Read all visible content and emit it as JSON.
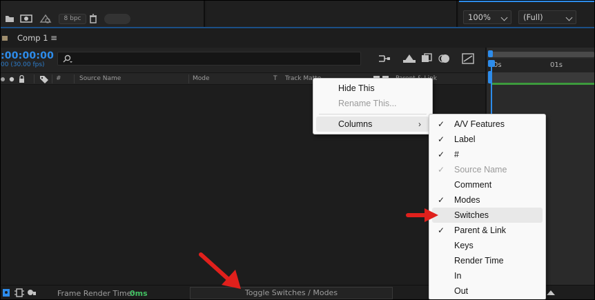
{
  "toolbar": {
    "bpc_label": "8 bpc",
    "zoom_value": "100%",
    "resolution_value": "(Full)"
  },
  "comp_tab": {
    "title": "Comp 1",
    "menu_glyph": "≡"
  },
  "timeline": {
    "timecode": ":00:00:00",
    "fps_text": "00 (30.00 fps)",
    "ruler_ticks": [
      "0s",
      "01s"
    ]
  },
  "columns": {
    "number": "#",
    "source_name": "Source Name",
    "mode": "Mode",
    "t": "T",
    "track_matte": "Track Matte",
    "parent_link": "Parent & Link"
  },
  "bottom": {
    "frame_render_label": "Frame Render Time:",
    "frame_render_value": "0ms",
    "toggle_label": "Toggle Switches / Modes"
  },
  "context_menu": {
    "items": [
      {
        "label": "Hide This",
        "enabled": true
      },
      {
        "label": "Rename This...",
        "enabled": false
      },
      {
        "label": "Columns",
        "enabled": true,
        "submenu": true
      }
    ]
  },
  "columns_submenu": {
    "items": [
      {
        "label": "A/V Features",
        "checked": true,
        "enabled": true
      },
      {
        "label": "Label",
        "checked": true,
        "enabled": true
      },
      {
        "label": "#",
        "checked": true,
        "enabled": true
      },
      {
        "label": "Source Name",
        "checked": true,
        "enabled": false
      },
      {
        "label": "Comment",
        "checked": false,
        "enabled": true
      },
      {
        "label": "Modes",
        "checked": true,
        "enabled": true
      },
      {
        "label": "Switches",
        "checked": false,
        "enabled": true,
        "highlighted": true
      },
      {
        "label": "Parent & Link",
        "checked": true,
        "enabled": true
      },
      {
        "label": "Keys",
        "checked": false,
        "enabled": true
      },
      {
        "label": "Render Time",
        "checked": false,
        "enabled": true
      },
      {
        "label": "In",
        "checked": false,
        "enabled": true
      },
      {
        "label": "Out",
        "checked": false,
        "enabled": true
      }
    ]
  },
  "colors": {
    "accent_blue": "#2d8ceb",
    "render_time_green": "#42c062",
    "annotation_red": "#e0201c",
    "label_swatch": "#a08e6e"
  },
  "glyphs": {
    "check": "✓",
    "submenu_arrow": "›"
  }
}
